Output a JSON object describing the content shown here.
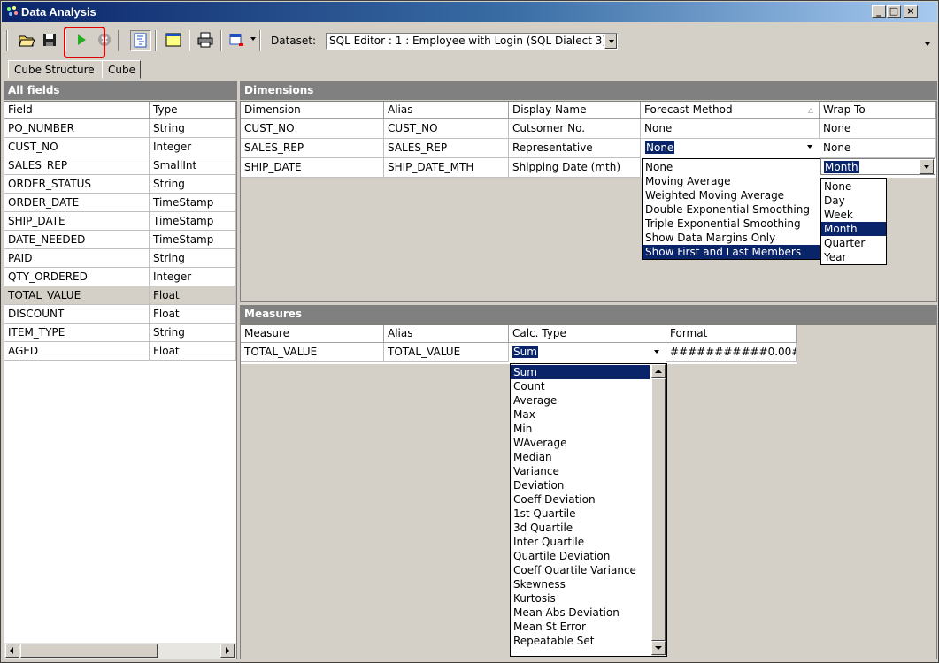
{
  "window": {
    "title": "Data Analysis",
    "min": "_",
    "max": "□",
    "close": "×"
  },
  "toolbar": {
    "dataset_label": "Dataset:",
    "dataset_value": "SQL Editor : 1 : Employee with Login (SQL Dialect 3)",
    "icons": [
      "open-folder-icon",
      "save-icon",
      "run-icon",
      "stop-icon",
      "structure-icon",
      "window-icon",
      "print-icon",
      "calendar-icon"
    ]
  },
  "tabs": [
    "Cube Structure",
    "Cube"
  ],
  "all_fields": {
    "header": "All fields",
    "columns": [
      "Field",
      "Type"
    ],
    "rows": [
      [
        "PO_NUMBER",
        "String"
      ],
      [
        "CUST_NO",
        "Integer"
      ],
      [
        "SALES_REP",
        "SmallInt"
      ],
      [
        "ORDER_STATUS",
        "String"
      ],
      [
        "ORDER_DATE",
        "TimeStamp"
      ],
      [
        "SHIP_DATE",
        "TimeStamp"
      ],
      [
        "DATE_NEEDED",
        "TimeStamp"
      ],
      [
        "PAID",
        "String"
      ],
      [
        "QTY_ORDERED",
        "Integer"
      ],
      [
        "TOTAL_VALUE",
        "Float"
      ],
      [
        "DISCOUNT",
        "Float"
      ],
      [
        "ITEM_TYPE",
        "String"
      ],
      [
        "AGED",
        "Float"
      ]
    ],
    "selected_row": 9
  },
  "dimensions": {
    "header": "Dimensions",
    "columns": [
      "Dimension",
      "Alias",
      "Display Name",
      "Forecast Method",
      "Wrap To"
    ],
    "rows": [
      [
        "CUST_NO",
        "CUST_NO",
        "Cutsomer No.",
        "None",
        "None"
      ],
      [
        "SALES_REP",
        "SALES_REP",
        "Representative",
        "None",
        "None"
      ],
      [
        "SHIP_DATE",
        "SHIP_DATE_MTH",
        "Shipping Date (mth)",
        "None",
        "Month"
      ]
    ],
    "forecast_options": [
      "None",
      "Moving Average",
      "Weighted Moving Average",
      "Double Exponential Smoothing",
      "Triple Exponential Smoothing",
      "Show Data Margins Only",
      "Show First and Last Members"
    ],
    "forecast_highlighted": 6,
    "wrap_options": [
      "None",
      "Day",
      "Week",
      "Month",
      "Quarter",
      "Year"
    ],
    "wrap_highlighted": 3
  },
  "measures": {
    "header": "Measures",
    "columns": [
      "Measure",
      "Alias",
      "Calc. Type",
      "Format"
    ],
    "rows": [
      [
        "TOTAL_VALUE",
        "TOTAL_VALUE",
        "Sum",
        "###########0.00#"
      ]
    ],
    "calc_options": [
      "Sum",
      "Count",
      "Average",
      "Max",
      "Min",
      "WAverage",
      "Median",
      "Variance",
      "Deviation",
      "Coeff Deviation",
      "1st Quartile",
      "3d Quartile",
      "Inter Quartile",
      "Quartile Deviation",
      "Coeff Quartile Variance",
      "Skewness",
      "Kurtosis",
      "Mean Abs Deviation",
      "Mean St Error",
      "Repeatable Set"
    ],
    "calc_highlighted": 0
  },
  "colors": {
    "title_start": "#0a246a",
    "title_end": "#a6caf0",
    "panel_header": "#808080",
    "selection": "#0a246a",
    "highlight_box": "#e00000"
  }
}
